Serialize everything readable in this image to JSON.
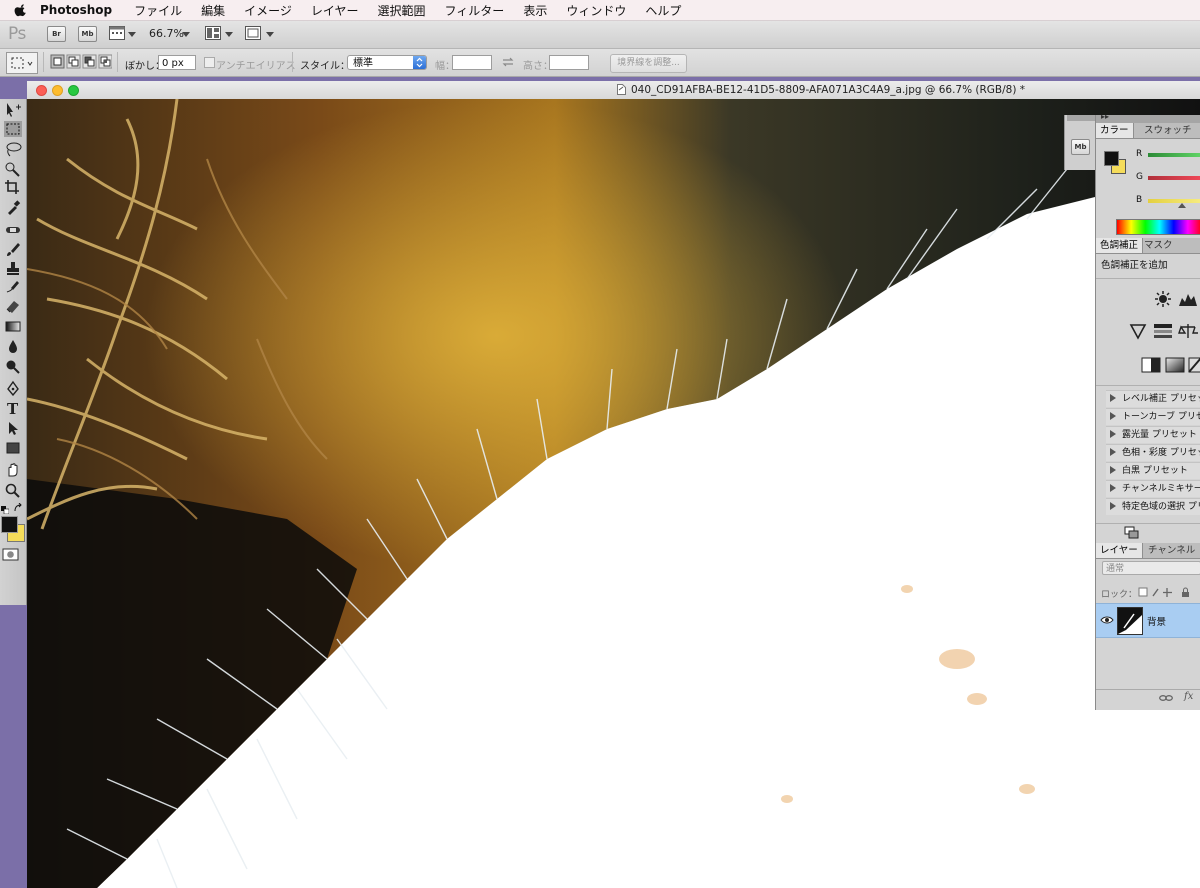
{
  "menubar": {
    "app_name": "Photoshop",
    "items": [
      "ファイル",
      "編集",
      "イメージ",
      "レイヤー",
      "選択範囲",
      "フィルター",
      "表示",
      "ウィンドウ",
      "ヘルプ"
    ]
  },
  "appbar": {
    "logo": "Ps",
    "bridge": "Br",
    "minibridge": "Mb",
    "zoom": "66.7%"
  },
  "options": {
    "feather_label": "ぼかし：",
    "feather_value": "0 px",
    "antialias_label": "アンチエイリアス",
    "style_label": "スタイル：",
    "style_value": "標準",
    "width_label": "幅：",
    "height_label": "高さ：",
    "refine_edge": "境界線を調整..."
  },
  "document": {
    "title": "040_CD91AFBA-BE12-41D5-8809-AFA071A3C4A9_a.jpg @ 66.7% (RGB/8) *"
  },
  "panel_strip": {
    "mb": "Mb"
  },
  "color_panel": {
    "tabs": [
      "カラー",
      "スウォッチ"
    ],
    "channels": [
      "R",
      "G",
      "B"
    ],
    "fg_color": "#111111",
    "bg_color": "#f5dc5a"
  },
  "adjustments_panel": {
    "tabs": [
      "色調補正",
      "マスク"
    ],
    "add_label": "色調補正を追加",
    "presets": [
      "レベル補正 プリセット",
      "トーンカーブ プリセット",
      "露光量 プリセット",
      "色相・彩度 プリセット",
      "白黒 プリセット",
      "チャンネルミキサー プリセット",
      "特定色域の選択 プリセット"
    ]
  },
  "layers_panel": {
    "tabs": [
      "レイヤー",
      "チャンネル"
    ],
    "blend_mode": "通常",
    "lock_label": "ロック：",
    "layer_name": "背景",
    "fx": "fx"
  }
}
